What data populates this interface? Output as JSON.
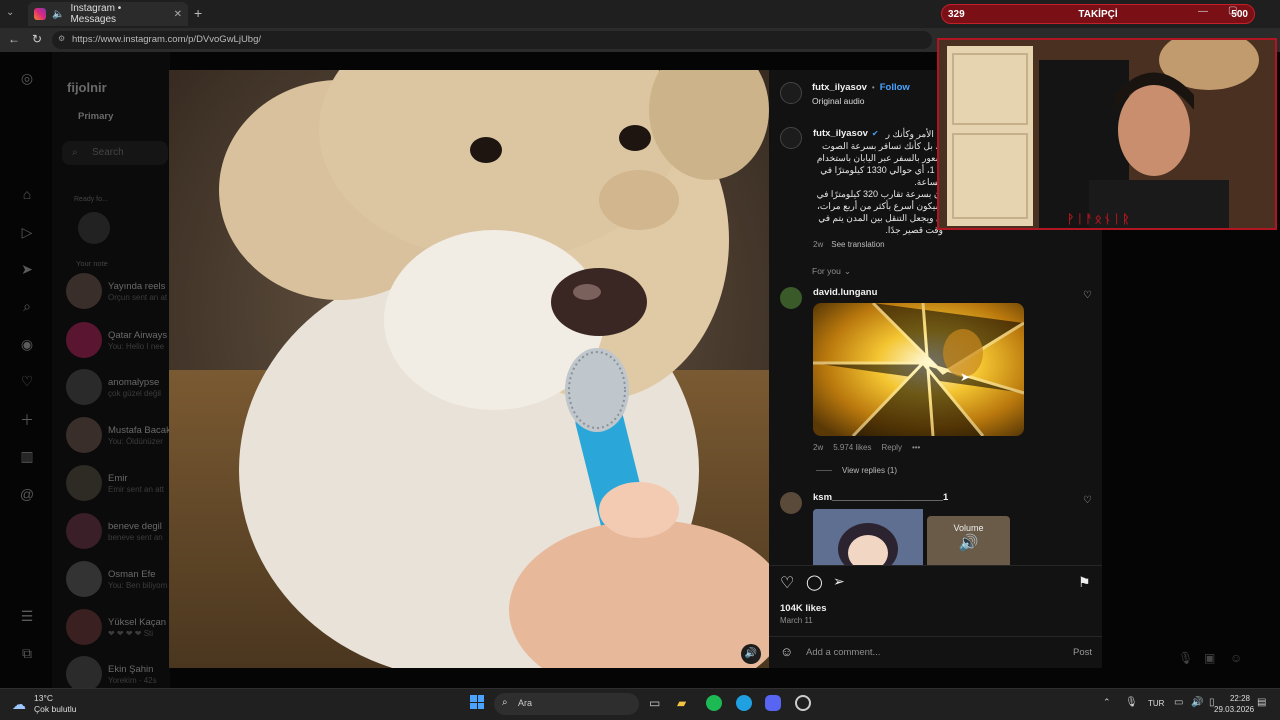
{
  "browser": {
    "tab_title": "Instagram • Messages",
    "url": "https://www.instagram.com/p/DVvoGwLjUbg/",
    "new_tab": "+"
  },
  "overlay": {
    "left_count": "329",
    "label": "TAKİPÇİ",
    "right_count": "500",
    "webcam_badge": "ᚹᛁᚨᛟᚾᛁᚱ"
  },
  "sidebar": {
    "username": "fijolnir",
    "tab_primary": "Primary",
    "search_placeholder": "Search",
    "note_label": "Ready fo...",
    "note_caption": "Your note"
  },
  "dms": [
    {
      "name": "Yayında reels",
      "sub": "Orçun sent an at"
    },
    {
      "name": "Qatar Airways",
      "sub": "You: Hello I nee"
    },
    {
      "name": "anomalypse",
      "sub": "çok güzel değil"
    },
    {
      "name": "Mustafa Bacak",
      "sub": "You: Öldünüzer"
    },
    {
      "name": "Emir",
      "sub": "Emir sent an att"
    },
    {
      "name": "beneve degil",
      "sub": "beneve sent an"
    },
    {
      "name": "Osman Efe",
      "sub": "You: Ben biliyom"
    },
    {
      "name": "Yüksel Kaçan",
      "sub": "❤ ❤ ❤ ❤ Sti"
    },
    {
      "name": "Ekin Şahin",
      "sub": "Yorekim · 42s"
    }
  ],
  "post": {
    "author": "futx_ilyasov",
    "follow": "Follow",
    "audio": "Original audio",
    "caption_author": "futx_ilyasov",
    "caption_lines": [
      "ن الأمر وكأنك ر",
      "ة، بل كأنك تسافر بسرعة الصوت",
      "شعور بالسفر عبر اليابان باستخدام",
      "خ 1، أي حوالي 1330 كيلومترًا في",
      "الساعة.",
      "ان بسرعة تقارب 320 كيلومترًا في",
      "سيكون أسرع بأكثر من أربع مرات،",
      "ي ويجعل التنقل بين المدن يتم في",
      "وقت قصير جدًا."
    ],
    "caption_time": "2w",
    "see_translation": "See translation",
    "for_you": "For you",
    "likes": "104K likes",
    "date": "March 11",
    "add_comment": "Add a comment...",
    "post_button": "Post"
  },
  "comments": [
    {
      "user": "david.lunganu",
      "time": "2w",
      "likes": "5.974 likes",
      "reply": "Reply",
      "more": "•••",
      "view_replies": "View replies (1)"
    },
    {
      "user": "ksm_____________________1",
      "thumb_label": "Volume"
    }
  ],
  "taskbar": {
    "weather_temp": "13°C",
    "weather_desc": "Çok bulutlu",
    "search": "Ara",
    "lang": "TUR",
    "time": "22:28",
    "date": "29.03.2026"
  },
  "colors": {
    "accent": "#4aa3ff",
    "overlay_red": "#b01622"
  }
}
